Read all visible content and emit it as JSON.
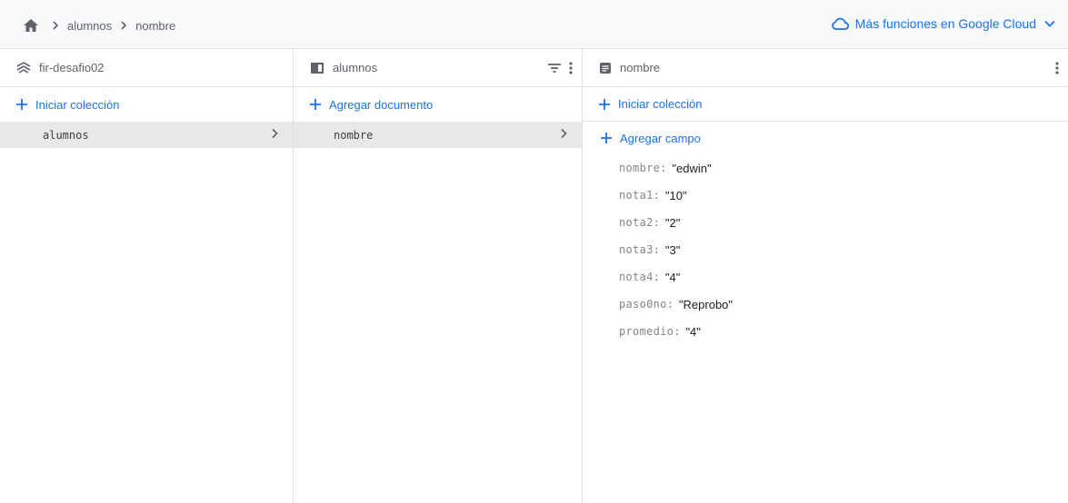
{
  "breadcrumb": {
    "items": [
      "alumnos",
      "nombre"
    ]
  },
  "cloud_link": {
    "label": "Más funciones en Google Cloud"
  },
  "colors": {
    "accent": "#1a73e8",
    "selected_row": "#e8e8e8",
    "header_bg": "#f8f9fa"
  },
  "columns": {
    "root": {
      "title": "fir-desafio02",
      "icon": "firestore-icon",
      "add_label": "Iniciar colección",
      "items": [
        {
          "label": "alumnos"
        }
      ]
    },
    "collection": {
      "title": "alumnos",
      "icon": "collection-icon",
      "add_label": "Agregar documento",
      "items": [
        {
          "label": "nombre"
        }
      ]
    },
    "document": {
      "title": "nombre",
      "icon": "document-icon",
      "add_collection_label": "Iniciar colección",
      "add_field_label": "Agregar campo",
      "fields": [
        {
          "key": "nombre",
          "value": "\"edwin\""
        },
        {
          "key": "nota1",
          "value": "\"10\""
        },
        {
          "key": "nota2",
          "value": "\"2\""
        },
        {
          "key": "nota3",
          "value": "\"3\""
        },
        {
          "key": "nota4",
          "value": "\"4\""
        },
        {
          "key": "paso0no",
          "value": "\"Reprobo\""
        },
        {
          "key": "promedio",
          "value": "\"4\""
        }
      ]
    }
  }
}
